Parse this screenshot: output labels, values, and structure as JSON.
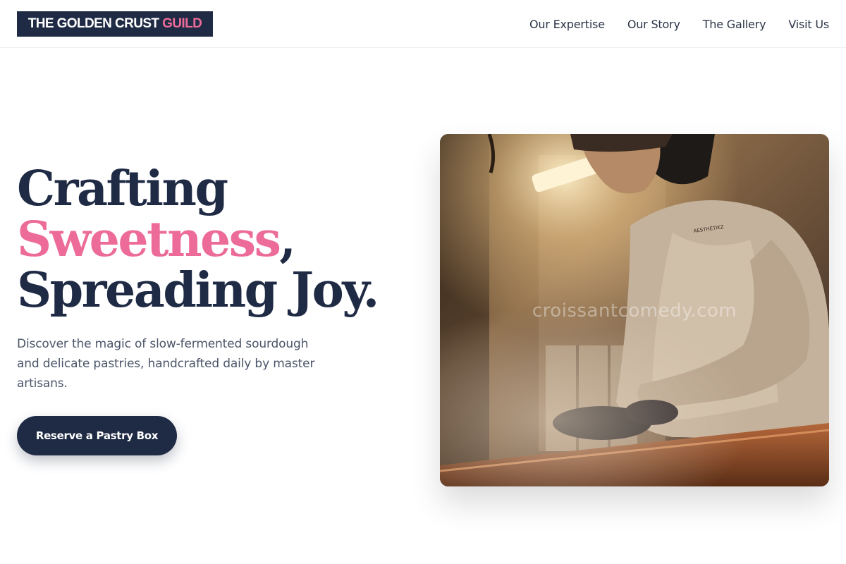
{
  "brand": {
    "name_main": "THE GOLDEN CRUST",
    "name_accent": "GUILD",
    "colors": {
      "navy": "#1f2a44",
      "pink": "#ec6b98"
    }
  },
  "nav": {
    "links": [
      "Our Expertise",
      "Our Story",
      "The Gallery",
      "Visit Us"
    ]
  },
  "hero": {
    "headline": {
      "line1": "Crafting",
      "line2_accent": "Sweetness",
      "line2_punct": ",",
      "line3": "Spreading Joy."
    },
    "subtext": "Discover the magic of slow-fermented sourdough and delicate pastries, handcrafted daily by master artisans.",
    "cta_label": "Reserve a Pastry Box",
    "image": {
      "subject": "baker working dough over a steaming bakery workbench",
      "watermark": "croissantcomedy.com",
      "shirt_print": "AESTHETIKZ"
    }
  }
}
